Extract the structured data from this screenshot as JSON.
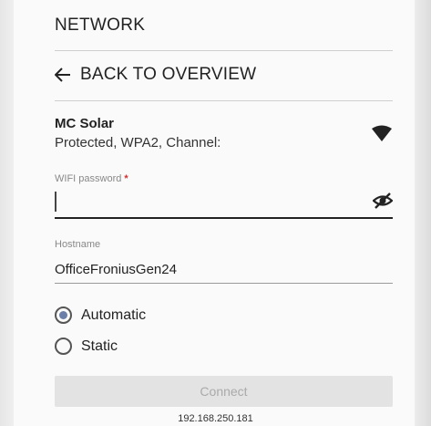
{
  "header": {
    "title": "NETWORK"
  },
  "navigation": {
    "back_label": "BACK TO OVERVIEW"
  },
  "network": {
    "name": "MC Solar",
    "details": "Protected, WPA2, Channel:"
  },
  "password": {
    "label": "WIFI password",
    "required_marker": "*",
    "value": ""
  },
  "hostname": {
    "label": "Hostname",
    "value": "OfficeFroniusGen24"
  },
  "ip_mode": {
    "options": [
      {
        "label": "Automatic",
        "selected": true
      },
      {
        "label": "Static",
        "selected": false
      }
    ]
  },
  "actions": {
    "connect_label": "Connect"
  },
  "footer": {
    "ip_address": "192.168.250.181"
  },
  "colors": {
    "accent": "#6b7fa8",
    "required": "#d32f2f",
    "button_disabled_bg": "#e3e3e3",
    "button_disabled_text": "#aaaaaa"
  },
  "icons": {
    "back": "arrow-left-icon",
    "wifi": "wifi-icon",
    "password_visibility": "eye-off-icon"
  }
}
